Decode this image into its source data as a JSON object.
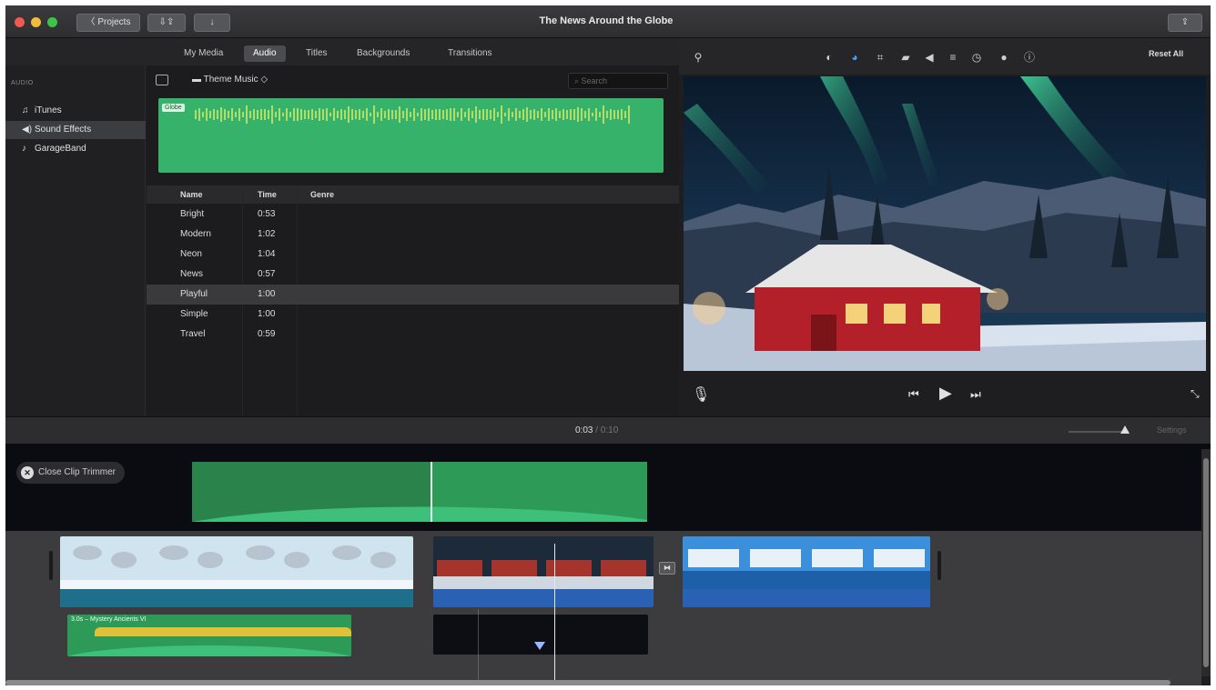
{
  "window": {
    "title": "The News Around the Globe",
    "projects_button": "〈 Projects"
  },
  "media_tabs": [
    {
      "label": "My Media",
      "active": false
    },
    {
      "label": "Audio",
      "active": true
    },
    {
      "label": "Titles",
      "active": false
    },
    {
      "label": "Backgrounds",
      "active": false
    },
    {
      "label": "Transitions",
      "active": false
    }
  ],
  "sidebar": {
    "heading": "AUDIO",
    "items": [
      {
        "label": "iTunes",
        "icon": "music-note-icon",
        "selected": false
      },
      {
        "label": "Sound Effects",
        "icon": "speaker-icon",
        "selected": true
      },
      {
        "label": "GarageBand",
        "icon": "guitar-icon",
        "selected": false
      }
    ]
  },
  "audio_browser": {
    "theme_select": "Theme Music ◇",
    "search_placeholder": "Search",
    "waveform_label": "Globe",
    "columns": {
      "name": "Name",
      "time": "Time",
      "genre": "Genre"
    },
    "rows": [
      {
        "name": "Bright",
        "time": "0:53",
        "selected": false
      },
      {
        "name": "Modern",
        "time": "1:02",
        "selected": false
      },
      {
        "name": "Neon",
        "time": "1:04",
        "selected": false
      },
      {
        "name": "News",
        "time": "0:57",
        "selected": false
      },
      {
        "name": "Playful",
        "time": "1:00",
        "selected": true
      },
      {
        "name": "Simple",
        "time": "1:00",
        "selected": false
      },
      {
        "name": "Travel",
        "time": "0:59",
        "selected": false
      }
    ]
  },
  "viewer": {
    "reset_all": "Reset All"
  },
  "timeline": {
    "timecode_current": "0:03",
    "timecode_total": "/ 0:10",
    "settings": "Settings",
    "close_clip_trimmer": "Close Clip Trimmer",
    "audio_clip_label": "3.0s – Mystery Ancients VI"
  },
  "colors": {
    "accent_blue": "#4aa3ff",
    "audio_green": "#2e9a58",
    "selection_gray": "#3a3a3d"
  }
}
